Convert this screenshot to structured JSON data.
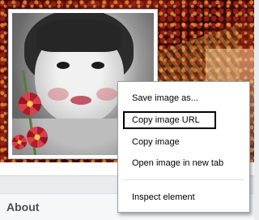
{
  "profile": {
    "about_label": "About"
  },
  "context_menu": {
    "items": [
      {
        "label": "Save image as..."
      },
      {
        "label": "Copy image URL",
        "highlighted": true
      },
      {
        "label": "Copy image"
      },
      {
        "label": "Open image in new tab"
      },
      {
        "label": "Inspect element"
      }
    ]
  },
  "colors": {
    "page_background": "#e9ebee",
    "menu_background": "#ffffff",
    "menu_border": "#a0a0a0",
    "highlight_border": "#000000",
    "about_text": "#4b4f56"
  }
}
